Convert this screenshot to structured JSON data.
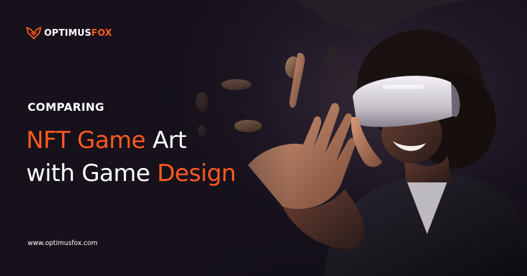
{
  "brand": {
    "name_part1": "OPTIMUS",
    "name_part2": "FOX"
  },
  "headline": {
    "kicker": "COMPARING",
    "line1_orange": "NFT Game",
    "line1_white": " Art",
    "line2_white": "with Game ",
    "line2_orange": "Design"
  },
  "footer": {
    "website": "www.optimusfox.com"
  },
  "colors": {
    "accent": "#ff5a1f",
    "background": "#17121d",
    "text": "#ffffff"
  },
  "icons": [
    "fox-logo-icon"
  ]
}
